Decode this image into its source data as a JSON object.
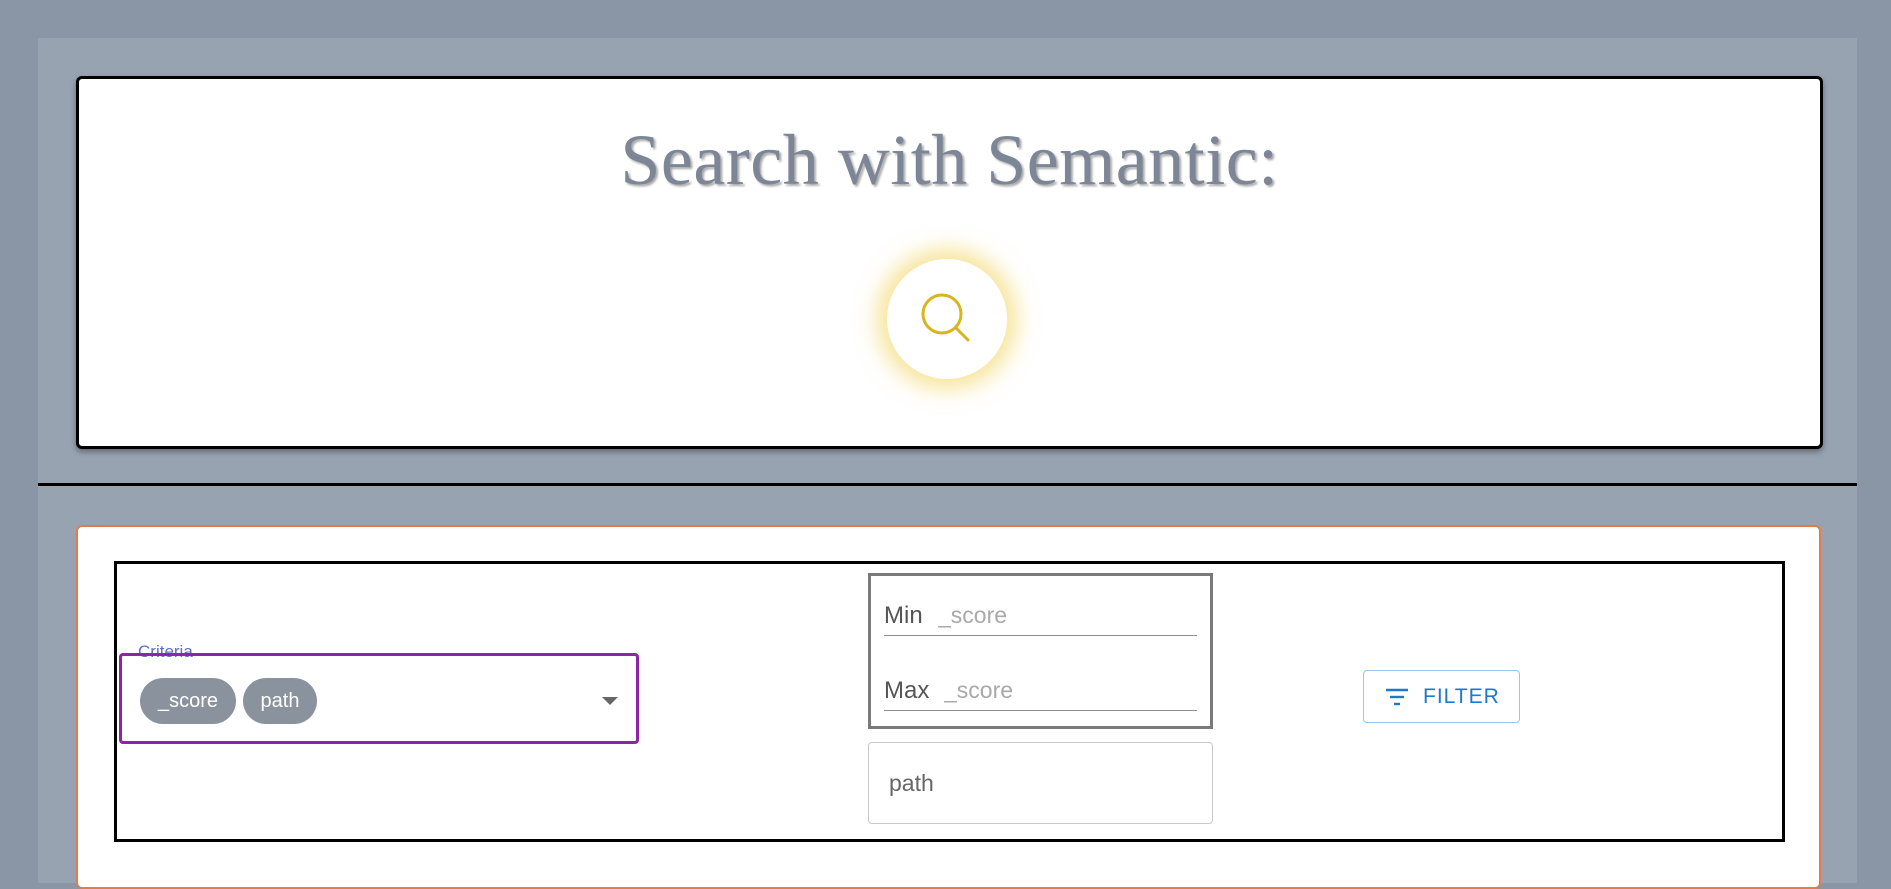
{
  "search": {
    "title": "Search with Semantic:",
    "button_icon": "search-icon",
    "icon_color": "#d8b41e"
  },
  "filter": {
    "criteria_label": "Criteria",
    "selected_criteria": [
      "_score",
      "path"
    ],
    "min_label": "Min",
    "min_placeholder": "_score",
    "max_label": "Max",
    "max_placeholder": "_score",
    "path_placeholder": "path",
    "button_label": "FILTER",
    "button_icon": "filter-list-icon"
  },
  "colors": {
    "background": "#8a96a6",
    "panel": "#98a3b1",
    "accent_orange": "#e07b4a",
    "accent_purple": "#8e24aa",
    "accent_blue": "#1e78d2"
  }
}
